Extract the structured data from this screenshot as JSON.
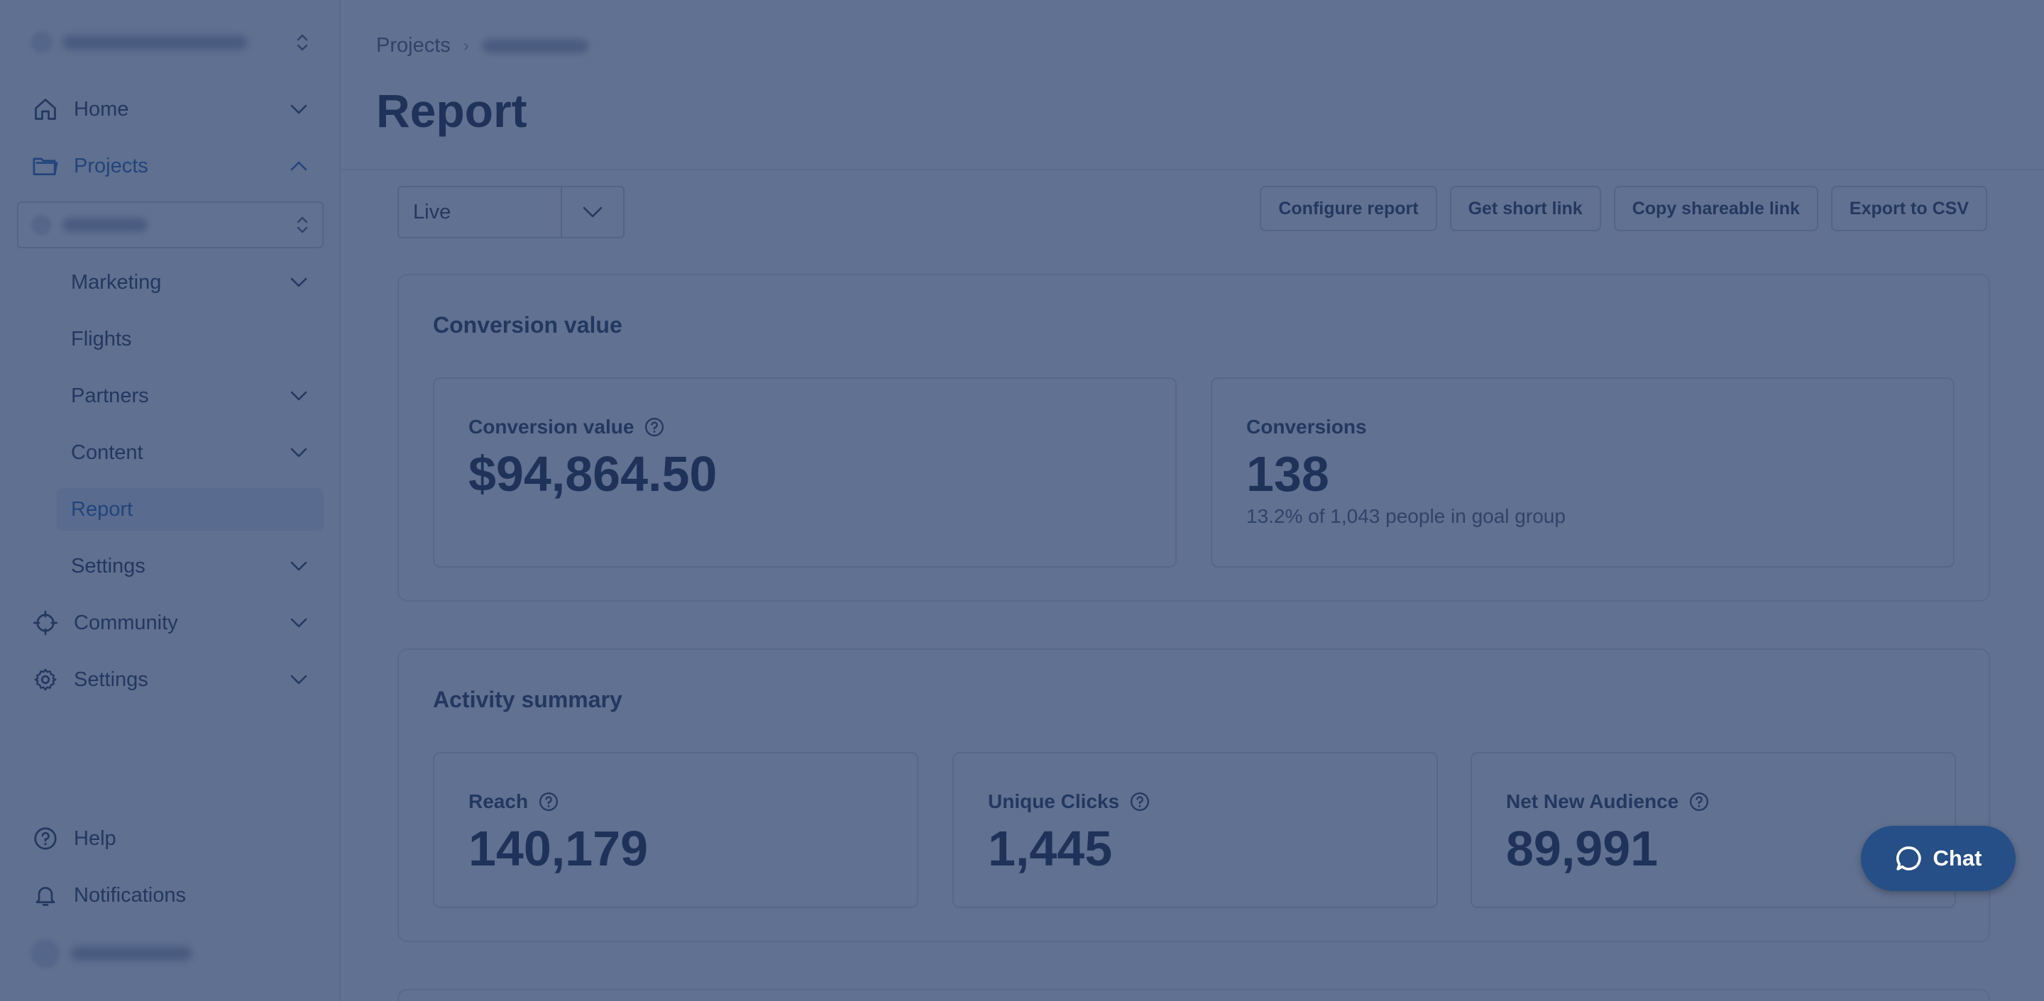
{
  "breadcrumb": {
    "root": "Projects",
    "current": ""
  },
  "page": {
    "title": "Report"
  },
  "sidebar": {
    "home": "Home",
    "projects": "Projects",
    "sub_items": [
      {
        "label": "Marketing"
      },
      {
        "label": "Flights"
      },
      {
        "label": "Partners"
      },
      {
        "label": "Content"
      },
      {
        "label": "Report"
      },
      {
        "label": "Settings"
      }
    ],
    "community": "Community",
    "settings": "Settings",
    "help": "Help",
    "notifications": "Notifications"
  },
  "toolbar": {
    "view_select": "Live",
    "buttons": [
      "Configure report",
      "Get short link",
      "Copy shareable link",
      "Export to CSV"
    ]
  },
  "conversion_section": {
    "title": "Conversion value",
    "cards": [
      {
        "label": "Conversion value",
        "value": "$94,864.50",
        "sub": ""
      },
      {
        "label": "Conversions",
        "value": "138",
        "sub": "13.2% of 1,043 people in goal group"
      }
    ]
  },
  "activity_section": {
    "title": "Activity summary",
    "cards": [
      {
        "label": "Reach",
        "value": "140,179"
      },
      {
        "label": "Unique Clicks",
        "value": "1,445"
      },
      {
        "label": "Net New Audience",
        "value": "89,991"
      }
    ]
  },
  "chat": {
    "label": "Chat"
  },
  "colors": {
    "overlay": "#243a66",
    "accent": "#1f5fae",
    "chat": "#254f86"
  }
}
